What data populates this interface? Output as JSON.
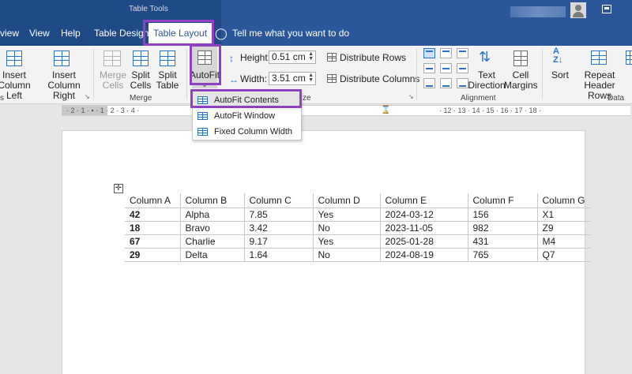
{
  "title_bar": {
    "context_label": "Table Tools"
  },
  "tabs": [
    {
      "label": "view",
      "display": "view"
    },
    {
      "label": "View"
    },
    {
      "label": "Help"
    },
    {
      "label": "Table Design"
    },
    {
      "label": "Table Layout"
    }
  ],
  "tell_me": "Tell me what you want to do",
  "ribbon": {
    "insert_left": [
      "Insert",
      "Column Left"
    ],
    "insert_right": [
      "Insert",
      "Column Right"
    ],
    "merge_cells": [
      "Merge",
      "Cells"
    ],
    "split_cells": [
      "Split",
      "Cells"
    ],
    "split_table": [
      "Split",
      "Table"
    ],
    "autofit": "AutoFit",
    "height_label": "Height:",
    "height_value": "0.51 cm",
    "width_label": "Width:",
    "width_value": "3.51 cm",
    "distribute_rows": "Distribute Rows",
    "distribute_columns": "Distribute Columns",
    "text_direction": [
      "Text",
      "Direction"
    ],
    "cell_margins": [
      "Cell",
      "Margins"
    ],
    "sort": "Sort",
    "repeat_header": [
      "Repeat",
      "Header Rows"
    ],
    "groups": {
      "rows_cols": "s",
      "merge": "Merge",
      "cell_size": "ze",
      "alignment": "Alignment",
      "data": "Data"
    }
  },
  "ruler": {
    "left_text": "· 2 · 1 · ▪ · 1 · 2 · 3 · 4 ·",
    "right_text": "· 12 · 13 · 14 · 15 · 16 · 17 · 18 ·"
  },
  "autofit_menu": {
    "items": [
      "AutoFit Contents",
      "AutoFit Window",
      "Fixed Column Width"
    ]
  },
  "table": {
    "headers": [
      "Column A",
      "Column B",
      "Column C",
      "Column D",
      "Column E",
      "Column F",
      "Column G"
    ],
    "rows": [
      [
        "42",
        "Alpha",
        "7.85",
        "Yes",
        "2024-03-12",
        "156",
        "X1"
      ],
      [
        "18",
        "Bravo",
        "3.42",
        "No",
        "2023-11-05",
        "982",
        "Z9"
      ],
      [
        "67",
        "Charlie",
        "9.17",
        "Yes",
        "2025-01-28",
        "431",
        "M4"
      ],
      [
        "29",
        "Delta",
        "1.64",
        "No",
        "2024-08-19",
        "765",
        "Q7"
      ]
    ]
  },
  "colors": {
    "accent": "#2b579a",
    "highlight": "#9140c5"
  }
}
